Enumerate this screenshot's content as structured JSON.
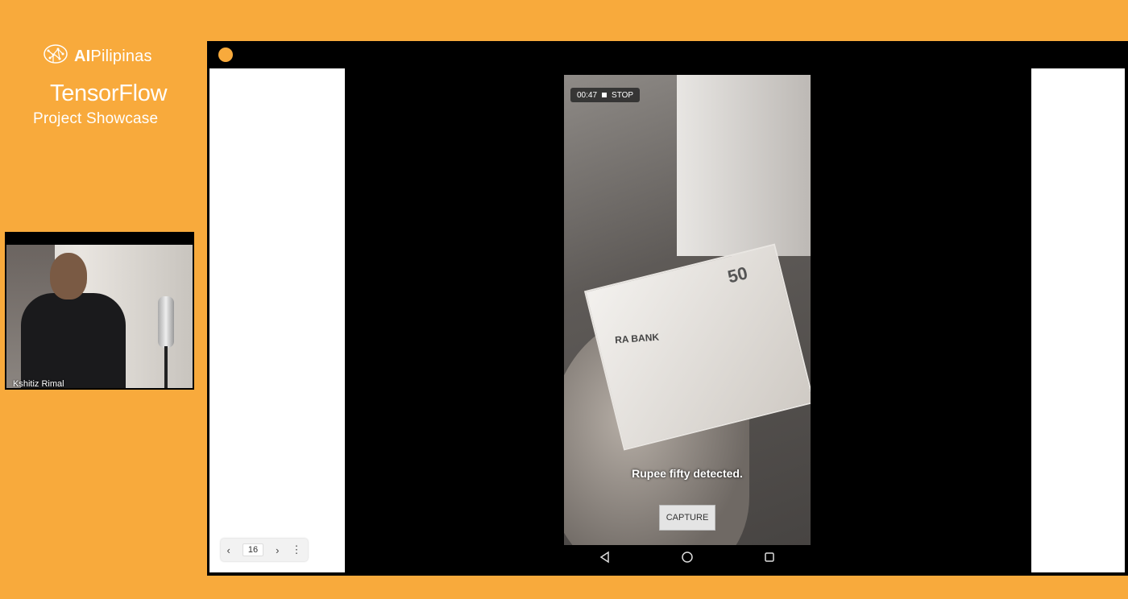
{
  "branding": {
    "logo_prefix": "AI",
    "logo_suffix": "Pilipinas",
    "title": "TensorFlow",
    "subtitle": "Project Showcase"
  },
  "webcam": {
    "participant_name": "Kshitiz Rimal"
  },
  "video": {
    "recording_time": "00:47",
    "stop_label": "STOP",
    "detection_text": "Rupee fifty detected.",
    "capture_label": "CAPTURE",
    "note_bank_text": "RA BANK",
    "note_value_text": "50"
  },
  "pager": {
    "prev_glyph": "‹",
    "page_number": "16",
    "next_glyph": "›",
    "more_glyph": "⋮"
  },
  "colors": {
    "background": "#F8AA3C",
    "record_dot": "#F8AA3C"
  },
  "icons": {
    "logo": "brain-network-icon",
    "back": "triangle-back-icon",
    "home": "circle-home-icon",
    "recents": "square-recents-icon"
  }
}
